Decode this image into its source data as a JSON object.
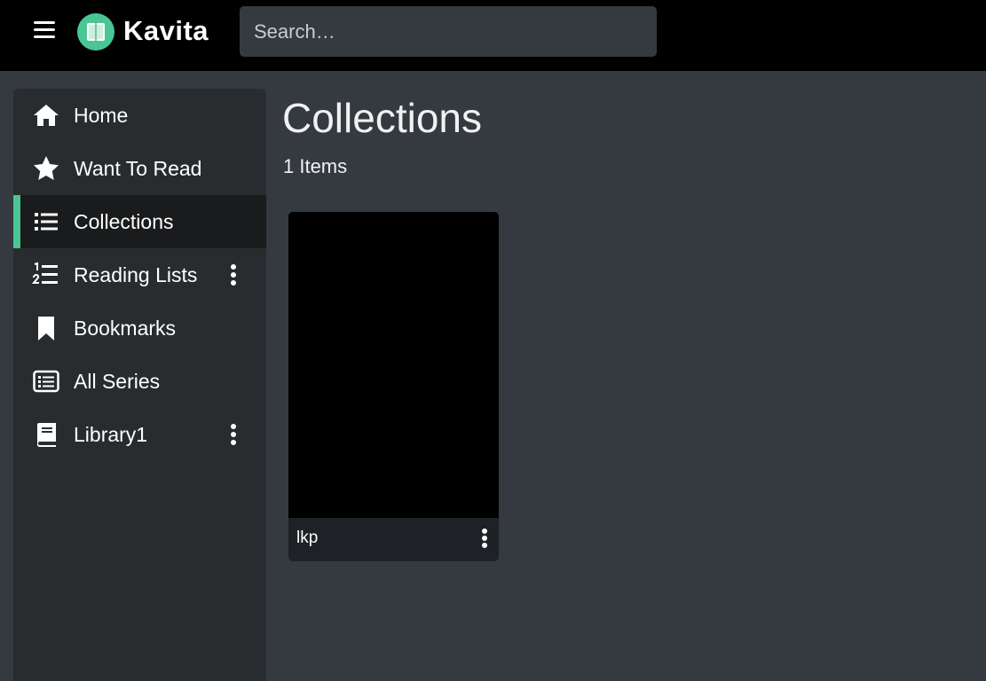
{
  "header": {
    "brand": "Kavita",
    "search_placeholder": "Search…"
  },
  "sidebar": {
    "items": [
      {
        "label": "Home",
        "icon": "home-icon"
      },
      {
        "label": "Want To Read",
        "icon": "star-icon"
      },
      {
        "label": "Collections",
        "icon": "list-icon",
        "active": true
      },
      {
        "label": "Reading Lists",
        "icon": "ordered-list-icon",
        "has_menu": true
      },
      {
        "label": "Bookmarks",
        "icon": "bookmark-icon"
      },
      {
        "label": "All Series",
        "icon": "rectangle-list-icon"
      },
      {
        "label": "Library1",
        "icon": "book-icon",
        "has_menu": true
      }
    ]
  },
  "main": {
    "title": "Collections",
    "count": "1 Items",
    "cards": [
      {
        "title": "lkp"
      }
    ]
  },
  "colors": {
    "accent": "#4ac694",
    "topbar": "#000000",
    "background": "#343a40",
    "sidebar": "#292c2f",
    "active_item": "#1a1b1d"
  }
}
